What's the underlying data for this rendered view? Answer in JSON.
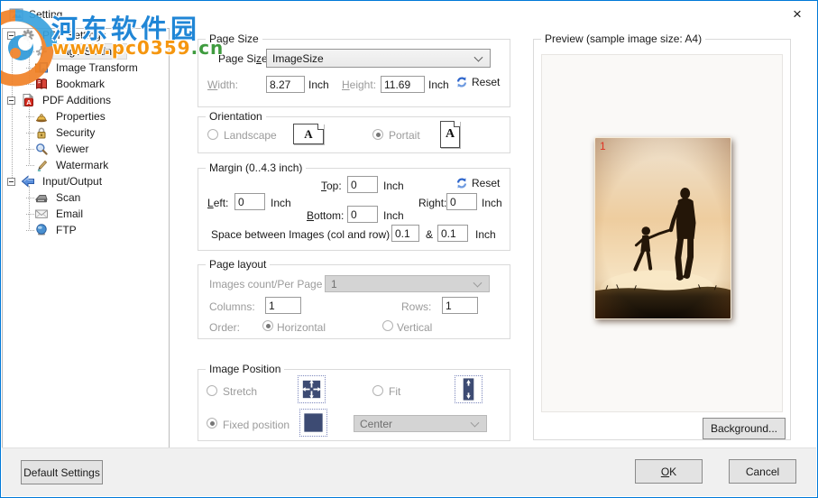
{
  "window": {
    "title": "Setting",
    "close_glyph": "×"
  },
  "watermark": {
    "site_name": "河东软件园",
    "url_orange": "www.pc0359",
    "url_green": ".cn"
  },
  "tree": {
    "items": [
      {
        "label": "PDF Settings"
      },
      {
        "label": "Page Settings"
      },
      {
        "label": "Image Transform"
      },
      {
        "label": "Bookmark"
      },
      {
        "label": "PDF Additions"
      },
      {
        "label": "Properties"
      },
      {
        "label": "Security"
      },
      {
        "label": "Viewer"
      },
      {
        "label": "Watermark"
      },
      {
        "label": "Input/Output"
      },
      {
        "label": "Scan"
      },
      {
        "label": "Email"
      },
      {
        "label": "FTP"
      }
    ]
  },
  "page_size": {
    "group_label": "Page Size",
    "field_label": "Page Si<u>z</u>e:",
    "value": "ImageSize",
    "width_label": "<u>W</u>idth:",
    "width_value": "8.27",
    "width_unit": "Inch",
    "height_label": "<u>H</u>eight:",
    "height_value": "11.69",
    "height_unit": "Inch",
    "reset_label": "Reset"
  },
  "orientation": {
    "group_label": "Orientation",
    "landscape_label": "Landscape",
    "portrait_label": "Portait",
    "icon_letter": "A"
  },
  "margin": {
    "group_label": "Margin (0..4.3 inch)",
    "top_label": "<u>T</u>op:",
    "top_value": "0",
    "left_label": "<u>L</u>eft:",
    "left_value": "0",
    "bottom_label": "<u>B</u>ottom:",
    "bottom_value": "0",
    "right_label": "Ri<u>g</u>ht:",
    "right_value": "0",
    "unit": "Inch",
    "reset_label": "Reset",
    "space_label": "Space between Images (col and row) :",
    "space_col_value": "0.1",
    "space_amp": "&",
    "space_row_value": "0.1"
  },
  "page_layout": {
    "group_label": "Page layout",
    "count_label": "Images count/Per Page",
    "count_value": "1",
    "columns_label": "Columns:",
    "columns_value": "1",
    "rows_label": "Rows:",
    "rows_value": "1",
    "order_label": "Order:",
    "horizontal_label": "Horizontal",
    "vertical_label": "Vertical"
  },
  "image_position": {
    "group_label": "Image Position",
    "stretch_label": "Stretch",
    "fit_label": "Fit",
    "fixed_label": "Fixed position",
    "position_value": "Center"
  },
  "preview": {
    "group_label": "Preview (sample image size: A4)",
    "page_number": "1",
    "background_label": "Background..."
  },
  "footer": {
    "default_label": "Default Settings",
    "ok_label": "<u>O</u>K",
    "cancel_label": "Cancel"
  },
  "colors": {
    "window_border": "#0079d8",
    "watermark_blue": "#2086d6",
    "watermark_orange": "#f5960f",
    "watermark_green": "#3f9b3f",
    "icon_navy": "#3d4b73",
    "page_number_red": "#e03222"
  }
}
